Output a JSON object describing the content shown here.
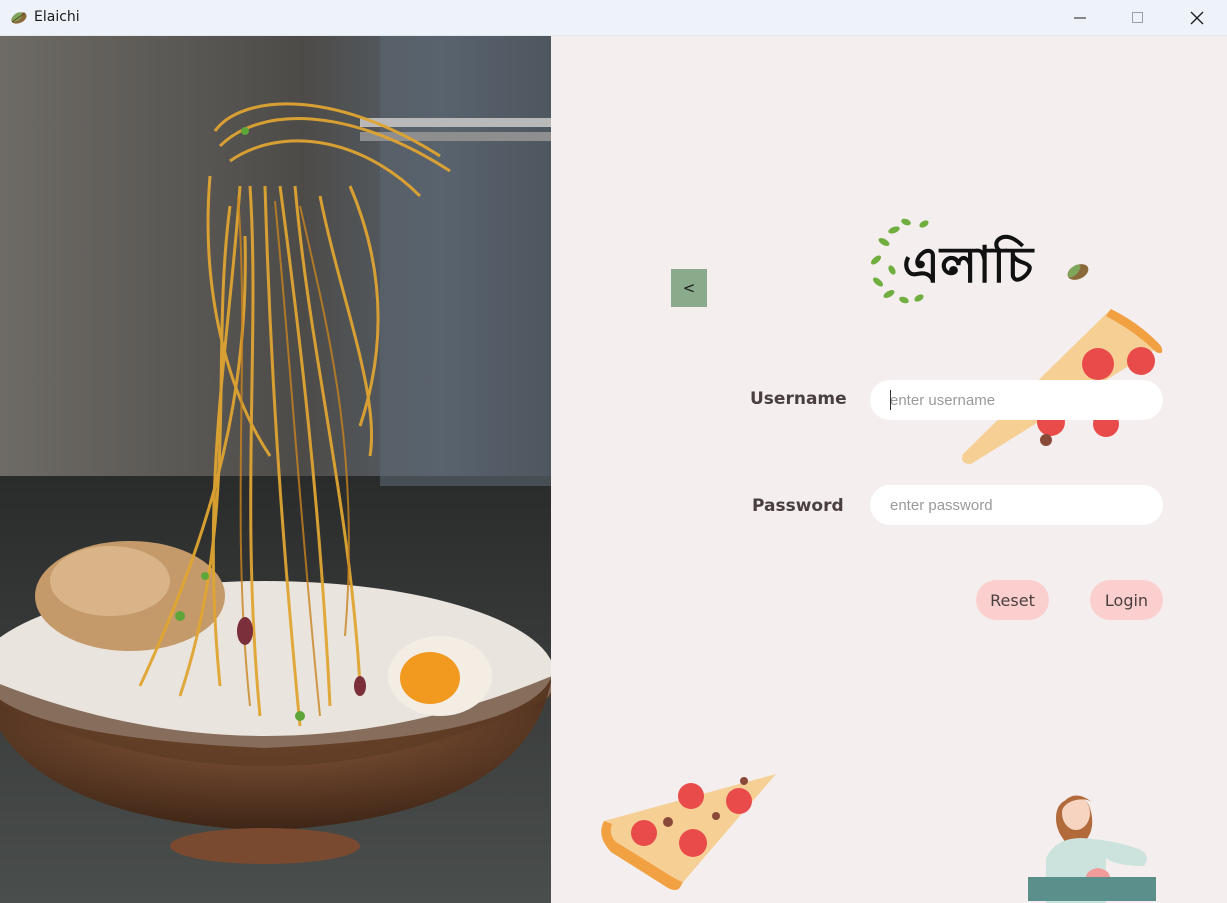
{
  "window": {
    "title": "Elaichi",
    "controls": [
      "minimize-icon",
      "maximize-icon",
      "close-icon"
    ]
  },
  "back_button": {
    "label": "<"
  },
  "logo": {
    "text": "এলাচি"
  },
  "form": {
    "username": {
      "label": "Username",
      "placeholder": "enter username",
      "value": ""
    },
    "password": {
      "label": "Password",
      "placeholder": "enter password",
      "value": ""
    }
  },
  "actions": {
    "reset_label": "Reset",
    "login_label": "Login"
  },
  "colors": {
    "panel_bg": "#f4eeee",
    "back_button_bg": "#8aab8b",
    "pill_button_bg": "#fccfcf",
    "label_text": "#4a3f3f"
  }
}
